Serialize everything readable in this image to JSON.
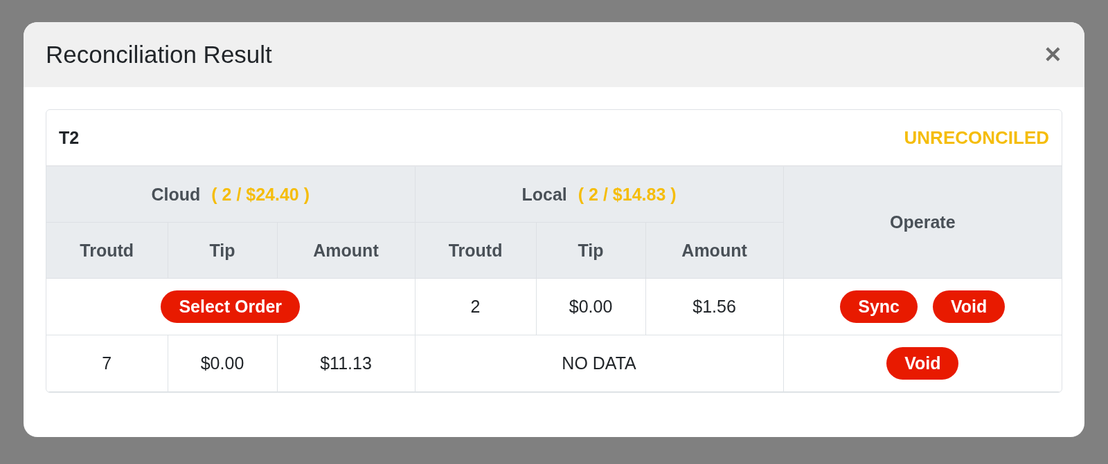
{
  "dialog": {
    "title": "Reconciliation Result",
    "close": "✕"
  },
  "card": {
    "terminal": "T2",
    "status": "UNRECONCILED"
  },
  "groups": [
    {
      "label": "Cloud",
      "summary": "( 2 / $24.40 )"
    },
    {
      "label": "Local",
      "summary": "( 2 / $14.83 )"
    },
    {
      "label": "Operate"
    }
  ],
  "columns": [
    [
      "Troutd",
      "Tip",
      "Amount"
    ],
    [
      "Troutd",
      "Tip",
      "Amount"
    ]
  ],
  "rows": [
    {
      "cloud": {
        "kind": "action",
        "label": "Select Order"
      },
      "local": {
        "kind": "values",
        "values": [
          "2",
          "$0.00",
          "$1.56"
        ]
      },
      "operate": [
        "Sync",
        "Void"
      ]
    },
    {
      "cloud": {
        "kind": "values",
        "values": [
          "7",
          "$0.00",
          "$11.13"
        ]
      },
      "local": {
        "kind": "empty",
        "text": "NO DATA"
      },
      "operate": [
        "Void"
      ]
    }
  ]
}
